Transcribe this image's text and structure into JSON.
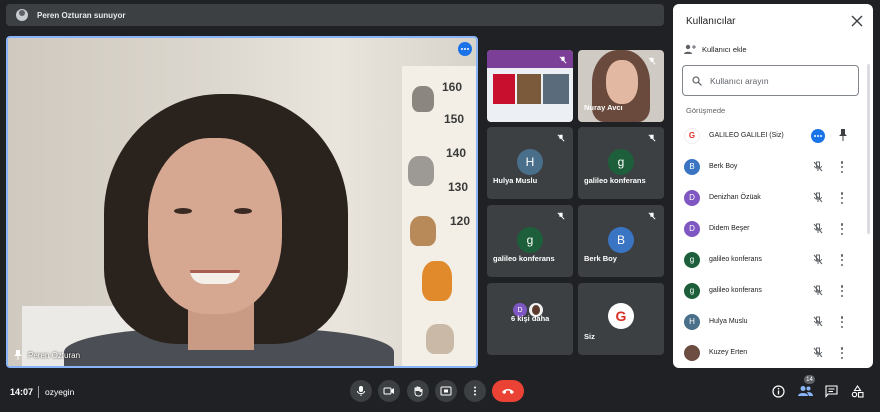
{
  "presenter_bar": {
    "text": "Peren Ozturan sunuyor"
  },
  "main_video": {
    "name": "Peren Ozturan",
    "chart_numbers": [
      "160",
      "150",
      "140",
      "130",
      "120"
    ]
  },
  "tiles": {
    "nuray": {
      "name": "Nuray Avcı"
    },
    "hulya": {
      "initial": "H",
      "name": "Hulya Muslu",
      "color": "#4a6f8a"
    },
    "galileo1": {
      "initial": "g",
      "name": "galileo konferans",
      "color": "#1e5f3b"
    },
    "galileo2": {
      "initial": "g",
      "name": "galileo konferans",
      "color": "#1e5f3b"
    },
    "berk": {
      "initial": "B",
      "name": "Berk Boy",
      "color": "#3a75c4"
    },
    "more": {
      "initial": "D",
      "label": "6 kişi daha"
    },
    "self": {
      "label": "Siz",
      "logo": "G"
    }
  },
  "panel": {
    "title": "Kullanıcılar",
    "add_user": "Kullanıcı ekle",
    "search_placeholder": "Kullanıcı arayın",
    "section": "Görüşmede",
    "participants": [
      {
        "initial": "G",
        "name": "GALILEO GALILEI (Siz)",
        "color": "#ffffff"
      },
      {
        "initial": "B",
        "name": "Berk Boy",
        "color": "#3a75c4"
      },
      {
        "initial": "D",
        "name": "Denizhan Özüak",
        "color": "#7e57c2"
      },
      {
        "initial": "D",
        "name": "Didem Beşer",
        "color": "#7e57c2"
      },
      {
        "initial": "g",
        "name": "galileo konferans",
        "color": "#1e5f3b"
      },
      {
        "initial": "g",
        "name": "galileo konferans",
        "color": "#1e5f3b"
      },
      {
        "initial": "H",
        "name": "Hulya Muslu",
        "color": "#4a6f8a"
      },
      {
        "initial": "",
        "name": "Kuzey Erten",
        "color": "#6d4c41"
      }
    ]
  },
  "bottom": {
    "time": "14:07",
    "meeting": "ozyegin",
    "participant_count": "14"
  },
  "colors": {
    "accent": "#1a73e8",
    "end_call": "#ea4335",
    "background": "#202124"
  }
}
